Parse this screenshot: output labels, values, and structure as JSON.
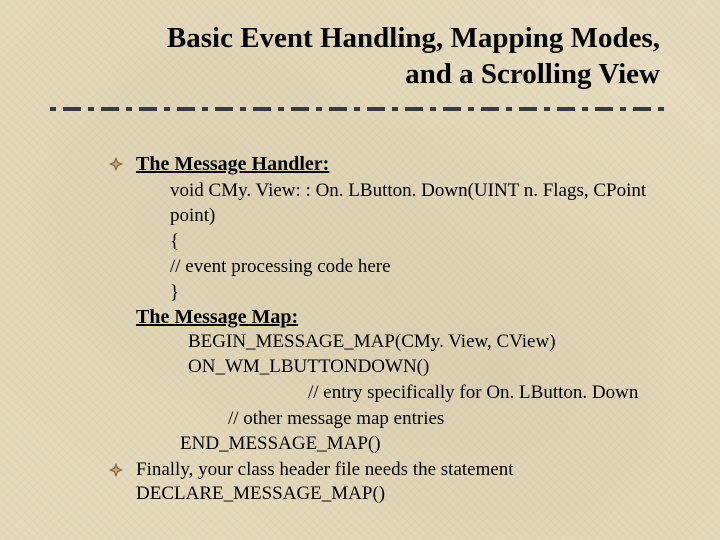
{
  "title_line1": "Basic Event Handling, Mapping Modes,",
  "title_line2": "and a Scrolling View",
  "section1_heading": "The Message Handler:",
  "code": {
    "l1": "void CMy. View: : On. LButton. Down(UINT n. Flags, CPoint point)",
    "l2": "{",
    "l3": " // event processing code here",
    "l4": "}"
  },
  "section2_heading": "The Message Map:",
  "map": {
    "l1": "BEGIN_MESSAGE_MAP(CMy. View, CView)",
    "l2": "ON_WM_LBUTTONDOWN()",
    "l3": "// entry specifically for On. LButton. Down",
    "l4": "// other message map entries",
    "l5": "END_MESSAGE_MAP()"
  },
  "final": {
    "l1": "Finally, your class header file needs the statement",
    "l2": "DECLARE_MESSAGE_MAP()"
  }
}
